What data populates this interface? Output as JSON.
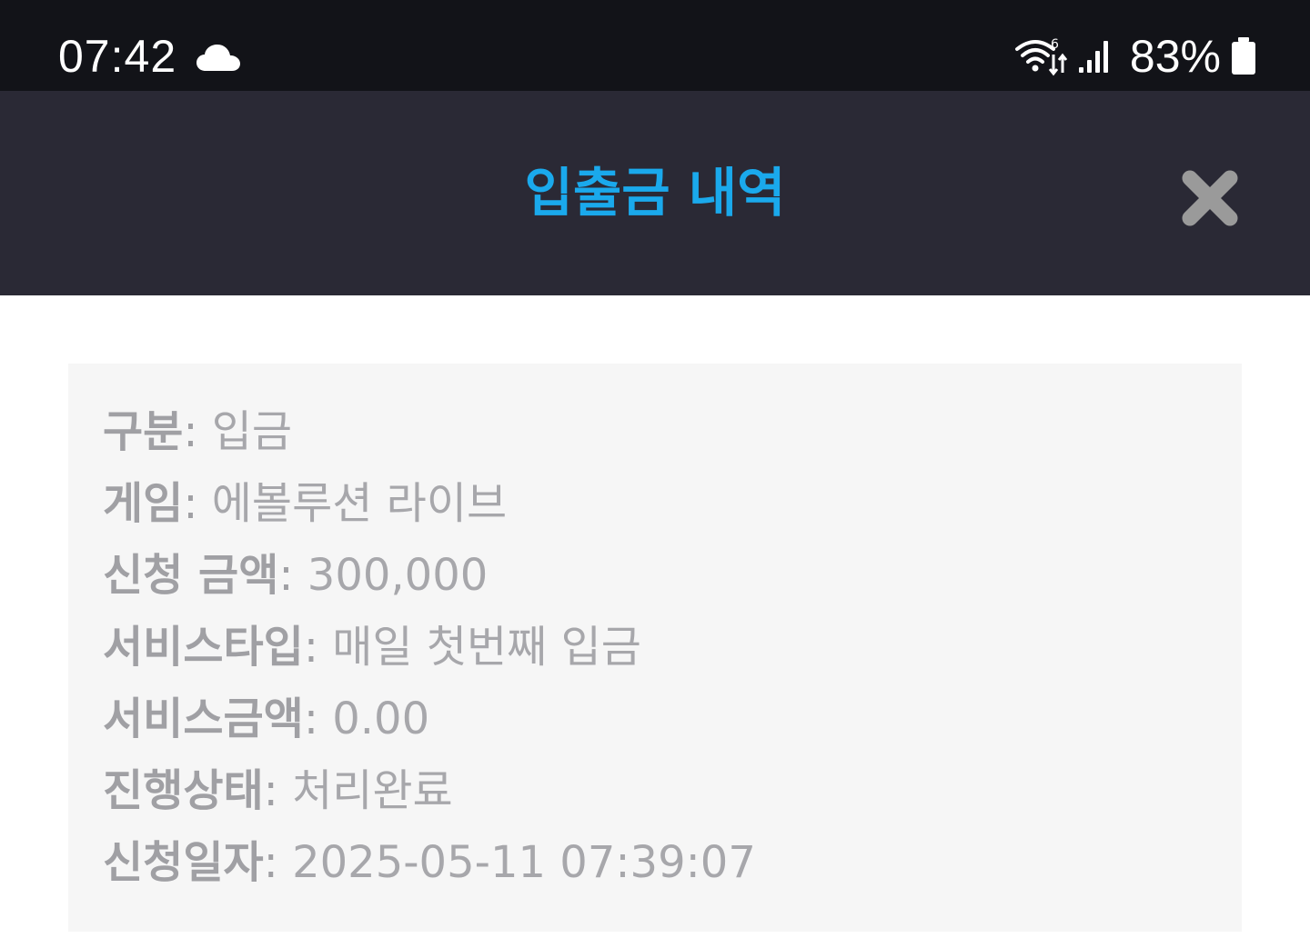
{
  "status_bar": {
    "time": "07:42",
    "weather_icon": "cloud-icon",
    "wifi_icon": "wifi-icon",
    "signal_icon": "signal-icon",
    "battery_percent": "83%",
    "battery_icon": "battery-icon"
  },
  "header": {
    "title": "입출금 내역",
    "title_color": "#1aa9ec",
    "close_icon": "close-icon"
  },
  "details": [
    {
      "label": "구분",
      "value": "입금"
    },
    {
      "label": "게임",
      "value": "에볼루션 라이브"
    },
    {
      "label": "신청 금액",
      "value": "300,000"
    },
    {
      "label": "서비스타입",
      "value": "매일 첫번째 입금"
    },
    {
      "label": "서비스금액",
      "value": "0.00"
    },
    {
      "label": "진행상태",
      "value": "처리완료"
    },
    {
      "label": "신청일자",
      "value": "2025-05-11 07:39:07"
    }
  ],
  "separator": ":"
}
